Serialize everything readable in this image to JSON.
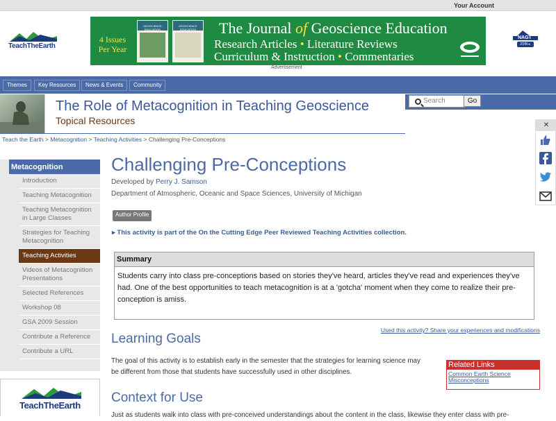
{
  "topbar": {
    "account": "Your Account"
  },
  "site": {
    "logo": "TeachTheEarth",
    "nagt_label": "NAGT",
    "nagt_join": "JOIN ▸"
  },
  "banner": {
    "issues": "4 Issues Per Year",
    "cover_label": "GEOSCIENCE EDUCATION",
    "title_pre": "The Journal ",
    "title_of": "of",
    "title_post": " Geoscience Education",
    "line2_a": "Research Articles",
    "line2_b": "Literature Reviews",
    "line3_a": "Curriculum & Instruction",
    "line3_b": "Commentaries",
    "dot": " • ",
    "advert": "Advertisement"
  },
  "nav": [
    "Themes",
    "Key Resources",
    "News & Events",
    "Community"
  ],
  "header": {
    "title": "The Role of Metacognition in Teaching Geoscience",
    "subtitle": "Topical Resources"
  },
  "search": {
    "placeholder": "Search",
    "go": "Go"
  },
  "breadcrumb": {
    "items": [
      "Teach the Earth",
      "Metacognition",
      "Teaching Activities"
    ],
    "sep": " > ",
    "current": "Challenging Pre-Conceptions"
  },
  "sidebar": {
    "heading": "Metacognition",
    "items": [
      "Introduction",
      "Teaching Metacognition",
      "Teaching Metacognition in Large Classes",
      "Strategies for Teaching Metacognition",
      "Teaching Activities",
      "Videos of Metacognition Presentations",
      "Selected References",
      "Workshop 08",
      "GSA 2009 Session",
      "Contribute a Reference",
      "Contribute a URL"
    ],
    "active": "Teaching Activities"
  },
  "main": {
    "title": "Challenging Pre-Conceptions",
    "developed_by": "Developed by ",
    "author": "Perry J. Samson",
    "dept": "Department of Atmospheric, Oceanic and Space Sciences, University of Michigan",
    "author_profile": "Author Profile",
    "cutting_edge": "This activity is part of the On the Cutting Edge Peer Reviewed Teaching Activities collection.",
    "summary_heading": "Summary",
    "summary": "Students carry into class pre-conceptions based on stories they've heard, articles they've read and experiences they've had. One of the best opportunities to teach metacognition is at a 'gotcha' moment when they come to realize their pre-conception is amiss.",
    "used_link": "Used this activity? Share your experiences and modifications",
    "goals_heading": "Learning Goals",
    "goals": "The goal of this activity is to establish early in the semester that the strategies for learning science may be different from those that students have successfully used in other disciplines.",
    "context_heading": "Context for Use",
    "context": "Just as students walk into class with pre-conceived understandings about the content in the class, likewise they enter class with pre-"
  },
  "related": {
    "heading": "Related Links",
    "link": "Common Earth Science Misconceptions"
  },
  "share": {
    "close": "✕"
  },
  "colors": {
    "nav_blue": "#4b6aa8",
    "brown": "#6b3a14",
    "banner_green": "#1f8a42",
    "related_red": "#c9302c"
  }
}
